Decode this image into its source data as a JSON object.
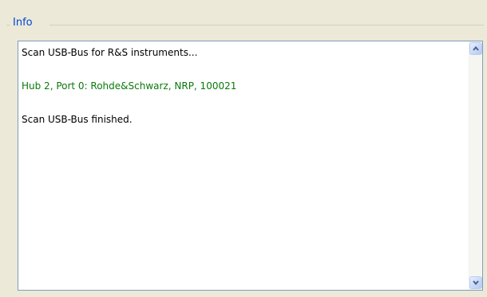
{
  "groupbox": {
    "title": "Info"
  },
  "log": {
    "lines": [
      {
        "text": "Scan USB-Bus for R&S instruments...",
        "color": "#000000"
      },
      {
        "text": "Hub 2, Port 0: Rohde&Schwarz, NRP, 100021",
        "color": "#0A7A0A"
      },
      {
        "text": "Scan USB-Bus finished.",
        "color": "#000000"
      }
    ]
  },
  "scrollbar": {
    "up_icon": "chevron-up-icon",
    "down_icon": "chevron-down-icon"
  }
}
